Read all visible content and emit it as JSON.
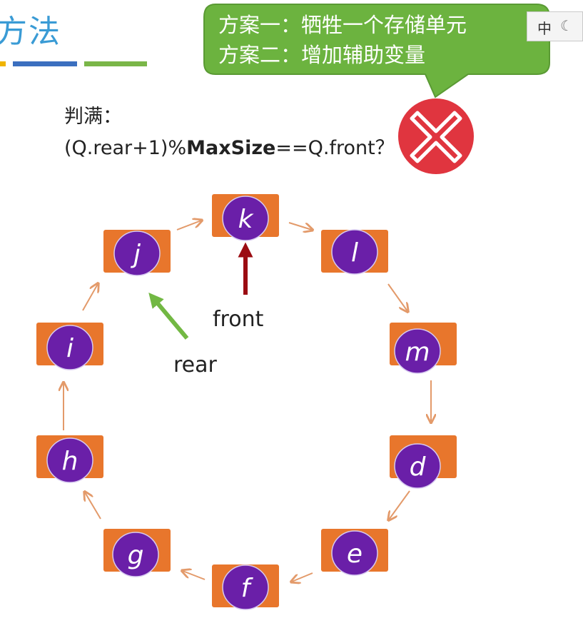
{
  "page": {
    "title_partial": "方法",
    "title_bar_colors": [
      "#f0b400",
      "#3b6fbf",
      "#7ab648"
    ]
  },
  "callout": {
    "line1": "方案一：牺牲一个存储单元",
    "line2": "方案二：增加辅助变量",
    "fill_color": "#6cb33f"
  },
  "ime": {
    "mode": "中",
    "icon": "moon-icon"
  },
  "condition": {
    "label": "判满：",
    "expr_prefix": "(Q.rear+1)%",
    "expr_bold": "MaxSize",
    "expr_suffix": "==Q.front？"
  },
  "status_icon": {
    "name": "wrong-x-icon",
    "color": "#e0353f"
  },
  "queue": {
    "nodes": [
      "k",
      "l",
      "m",
      "d",
      "e",
      "f",
      "g",
      "h",
      "i",
      "j"
    ],
    "box_color": "#e8762c",
    "circle_color": "#6a1fa8",
    "arrow_color": "#e39a6a"
  },
  "pointers": {
    "front": {
      "label": "front",
      "target": "k",
      "color": "#9b0c12"
    },
    "rear": {
      "label": "rear",
      "target": "j",
      "color": "#72b843"
    }
  }
}
